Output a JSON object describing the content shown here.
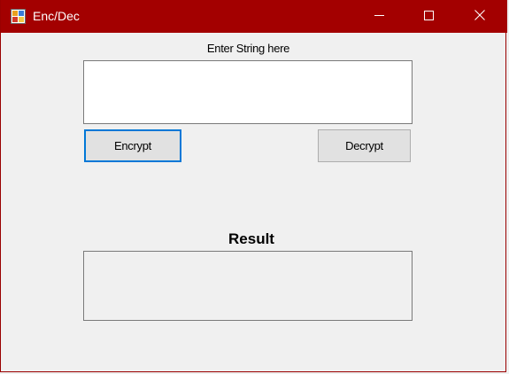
{
  "window": {
    "title": "Enc/Dec",
    "titlebar_color": "#a30000",
    "app_icon": "winforms-app-icon",
    "controls": {
      "minimize_icon": "minimize-icon",
      "maximize_icon": "maximize-icon",
      "close_icon": "close-icon"
    }
  },
  "form": {
    "input_label": "Enter String here",
    "input_value": "",
    "encrypt_label": "Encrypt",
    "decrypt_label": "Decrypt",
    "result_label": "Result",
    "result_value": "",
    "focus_color": "#0078d7"
  }
}
